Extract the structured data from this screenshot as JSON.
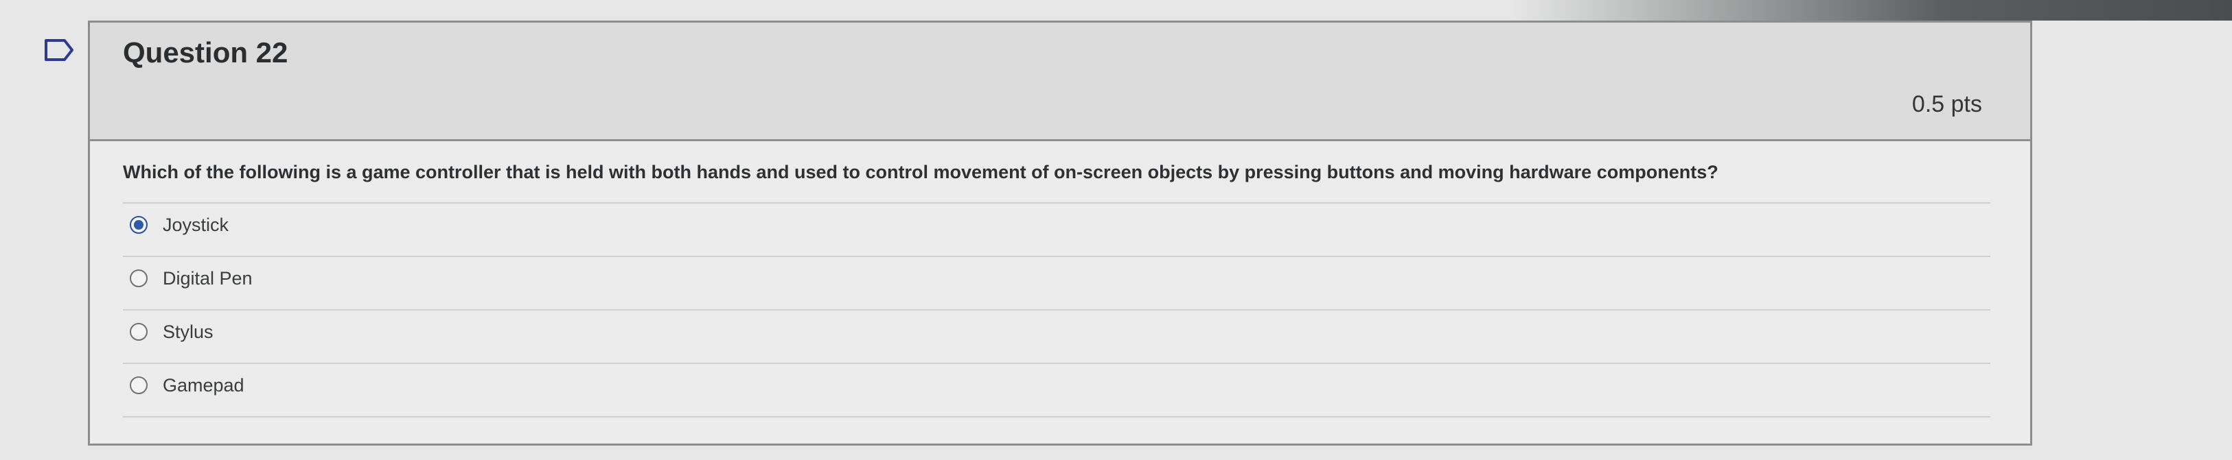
{
  "question": {
    "title": "Question 22",
    "points": "0.5 pts",
    "prompt": "Which of the following is a game controller that is held with both hands and used to control movement of on-screen objects by pressing buttons and moving hardware components?",
    "options": [
      {
        "label": "Joystick",
        "selected": true
      },
      {
        "label": "Digital Pen",
        "selected": false
      },
      {
        "label": "Stylus",
        "selected": false
      },
      {
        "label": "Gamepad",
        "selected": false
      }
    ]
  },
  "icons": {
    "flag": "flag-icon"
  },
  "colors": {
    "selected_radio": "#2f5aa8"
  }
}
